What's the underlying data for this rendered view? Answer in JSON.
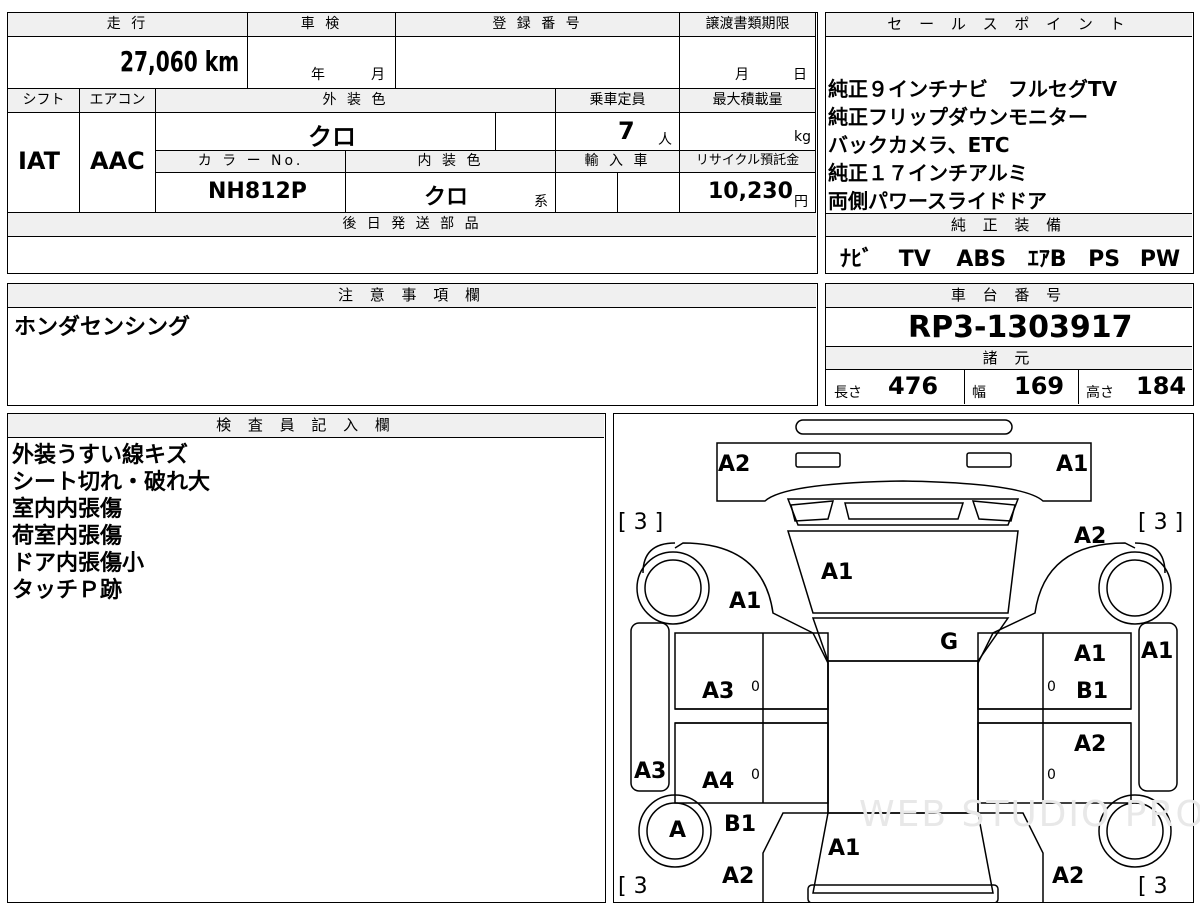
{
  "mileage": {
    "label": "走 行",
    "value": "27,060 km"
  },
  "inspection": {
    "label": "車 検",
    "year_label": "年",
    "month_label": "月"
  },
  "registration": {
    "label": "登 録 番 号",
    "value": ""
  },
  "transfer_deadline": {
    "label": "譲渡書類期限",
    "month_label": "月",
    "day_label": "日"
  },
  "shift": {
    "label": "シフト",
    "value": "IAT"
  },
  "aircon": {
    "label": "エアコン",
    "value": "AAC"
  },
  "exterior_color": {
    "label": "外 装 色",
    "value": "クロ"
  },
  "capacity": {
    "label": "乗車定員",
    "value": "7",
    "unit": "人"
  },
  "max_load": {
    "label": "最大積載量",
    "unit": "kg"
  },
  "color_no": {
    "label": "カ ラ ー No.",
    "value": "NH812P"
  },
  "interior_color": {
    "label": "内 装 色",
    "value": "クロ",
    "suffix": "系"
  },
  "import": {
    "label": "輸 入 車"
  },
  "recycle": {
    "label": "リサイクル預託金",
    "value": "10,230",
    "unit": "円"
  },
  "later_parts": {
    "label": "後 日 発 送 部 品"
  },
  "sales_points": {
    "label": "セ ー ル ス ポ イ ン ト",
    "items": [
      "純正９インチナビ　フルセグTV",
      "純正フリップダウンモニター",
      "バックカメラ、ETC",
      "純正１７インチアルミ",
      "両側パワースライドドア"
    ]
  },
  "equipment": {
    "label": "純 正 装 備",
    "items": [
      "ﾅﾋﾞ",
      "TV",
      "ABS",
      "ｴｱB",
      "PS",
      "PW"
    ]
  },
  "notes": {
    "label": "注 意 事 項 欄",
    "value": "ホンダセンシング"
  },
  "chassis": {
    "label": "車 台 番 号",
    "value": "RP3-1303917"
  },
  "specs": {
    "label": "諸 元",
    "length_label": "長さ",
    "length": "476",
    "width_label": "幅",
    "width": "169",
    "height_label": "高さ",
    "height": "184"
  },
  "inspector": {
    "label": "検 査 員 記 入 欄",
    "items": [
      "外装うすい線キズ",
      "シート切れ・破れ大",
      "室内内張傷",
      "荷室内張傷",
      "ドア内張傷小",
      "タッチＰ跡"
    ]
  },
  "diagram": {
    "marks": [
      "A2",
      "A1",
      "A2",
      "A1",
      "A1",
      "G",
      "A1",
      "A1",
      "A3",
      "B1",
      "A2",
      "A3",
      "A4",
      "A",
      "B1",
      "A1",
      "A2",
      "A2"
    ],
    "brackets": [
      "[ 3 ]",
      "[ 3 ]",
      "[ 3",
      "[ 3"
    ],
    "zeros": [
      "0",
      "0",
      "0",
      "0"
    ],
    "watermark": "WEB STUDIO PRO"
  }
}
